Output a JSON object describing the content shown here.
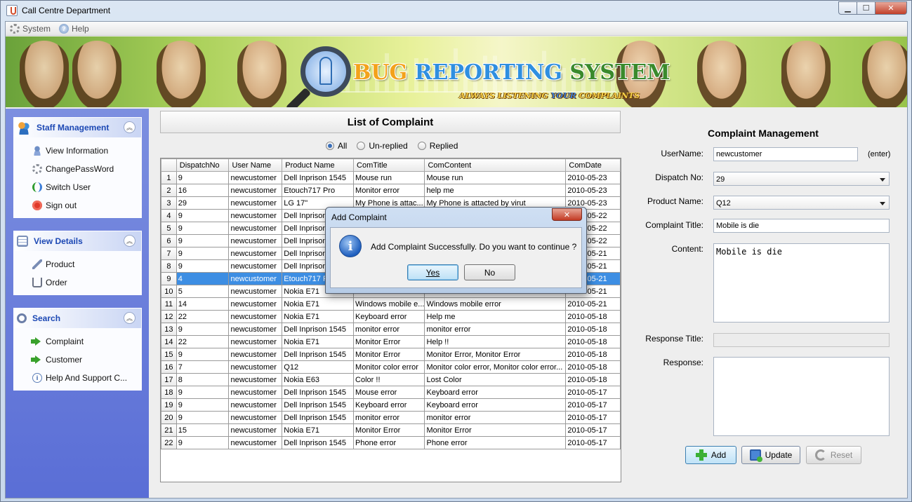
{
  "window": {
    "title": "Call Centre Department",
    "controls": {
      "minimize": "▁",
      "maximize": "☐",
      "close": "✕"
    }
  },
  "menu": [
    {
      "label": "System",
      "icon": "gear-icon"
    },
    {
      "label": "Help",
      "icon": "help-icon"
    }
  ],
  "banner": {
    "title_part1": "BUG ",
    "title_part2": "REPORTING ",
    "title_part3": "SYSTEM",
    "subtitle_part1": "ALWAYS LISTENING ",
    "subtitle_part2": "YOUR",
    "subtitle_part3": " COMPLAINTS"
  },
  "sidebar": {
    "groups": [
      {
        "title": "Staff Management",
        "icon": "staff-icon",
        "items": [
          {
            "label": "View Information",
            "icon": "user-icon"
          },
          {
            "label": "ChangePassWord",
            "icon": "gear-icon"
          },
          {
            "label": "Switch User",
            "icon": "switch-icon"
          },
          {
            "label": "Sign out",
            "icon": "power-icon"
          }
        ]
      },
      {
        "title": "View Details",
        "icon": "details-icon",
        "items": [
          {
            "label": "Product",
            "icon": "product-icon"
          },
          {
            "label": "Order",
            "icon": "cart-icon"
          }
        ]
      },
      {
        "title": "Search",
        "icon": "search-icon",
        "items": [
          {
            "label": "Complaint",
            "icon": "arrow-icon"
          },
          {
            "label": "Customer",
            "icon": "arrow-icon"
          },
          {
            "label": "Help And Support C...",
            "icon": "info-icon"
          }
        ]
      }
    ],
    "collapse_glyph": "︽"
  },
  "list": {
    "title": "List of Complaint",
    "filters": [
      {
        "label": "All",
        "selected": true
      },
      {
        "label": "Un-replied",
        "selected": false
      },
      {
        "label": "Replied",
        "selected": false
      }
    ],
    "columns": [
      "",
      "DispatchNo",
      "User Name",
      "Product Name",
      "ComTitle",
      "ComContent",
      "ComDate"
    ],
    "selected_row": 9,
    "rows": [
      [
        "1",
        "9",
        "newcustomer",
        "Dell Inprison 1545",
        "Mouse run",
        "Mouse run",
        "2010-05-23"
      ],
      [
        "2",
        "16",
        "newcustomer",
        "Etouch717 Pro",
        "Monitor error",
        "help me",
        "2010-05-23"
      ],
      [
        "3",
        "29",
        "newcustomer",
        "LG 17\"",
        "My Phone is attac...",
        "My Phone is attacted by virut",
        "2010-05-23"
      ],
      [
        "4",
        "9",
        "newcustomer",
        "Dell Inprison 1545",
        "",
        "",
        "2010-05-22"
      ],
      [
        "5",
        "9",
        "newcustomer",
        "Dell Inprison 1545",
        "",
        "",
        "2010-05-22"
      ],
      [
        "6",
        "9",
        "newcustomer",
        "Dell Inprison 1545",
        "",
        "",
        "2010-05-22"
      ],
      [
        "7",
        "9",
        "newcustomer",
        "Dell Inprison 1545",
        "",
        "",
        "2010-05-21"
      ],
      [
        "8",
        "9",
        "newcustomer",
        "Dell Inprison 1545",
        "",
        "",
        "2010-05-21"
      ],
      [
        "9",
        "4",
        "newcustomer",
        "Etouch717 Pro",
        "",
        "",
        "2010-05-21"
      ],
      [
        "10",
        "5",
        "newcustomer",
        "Nokia E71",
        "",
        "",
        "2010-05-21"
      ],
      [
        "11",
        "14",
        "newcustomer",
        "Nokia E71",
        "Windows mobile e...",
        "Windows mobile error",
        "2010-05-21"
      ],
      [
        "12",
        "22",
        "newcustomer",
        "Nokia E71",
        "Keyboard error",
        "Help me",
        "2010-05-18"
      ],
      [
        "13",
        "9",
        "newcustomer",
        "Dell Inprison 1545",
        "monitor error",
        "monitor error",
        "2010-05-18"
      ],
      [
        "14",
        "22",
        "newcustomer",
        "Nokia E71",
        "Monitor Error",
        "Help !!",
        "2010-05-18"
      ],
      [
        "15",
        "9",
        "newcustomer",
        "Dell Inprison 1545",
        "Monitor Error",
        "Monitor Error, Monitor Error",
        "2010-05-18"
      ],
      [
        "16",
        "7",
        "newcustomer",
        "Q12",
        "Monitor color error",
        "Monitor color error, Monitor color error...",
        "2010-05-18"
      ],
      [
        "17",
        "8",
        "newcustomer",
        "Nokia E63",
        "Color !!",
        "Lost Color",
        "2010-05-18"
      ],
      [
        "18",
        "9",
        "newcustomer",
        "Dell Inprison 1545",
        "Mouse error",
        "Keyboard error",
        "2010-05-17"
      ],
      [
        "19",
        "9",
        "newcustomer",
        "Dell Inprison 1545",
        "Keyboard error",
        "Keyboard error",
        "2010-05-17"
      ],
      [
        "20",
        "9",
        "newcustomer",
        "Dell Inprison 1545",
        "monitor error",
        "monitor error",
        "2010-05-17"
      ],
      [
        "21",
        "15",
        "newcustomer",
        "Nokia E71",
        "Monitor Error",
        "Monitor Error",
        "2010-05-17"
      ],
      [
        "22",
        "9",
        "newcustomer",
        "Dell Inprison 1545",
        "Phone error",
        "Phone error",
        "2010-05-17"
      ]
    ]
  },
  "form": {
    "title": "Complaint Management",
    "username_label": "UserName:",
    "username_value": "newcustomer",
    "enter_hint": "(enter)",
    "dispatch_label": "Dispatch No:",
    "dispatch_value": "29",
    "product_label": "Product Name:",
    "product_value": "Q12",
    "complaint_title_label": "Complaint Title:",
    "complaint_title_value": "Mobile is die",
    "content_label": "Content:",
    "content_value": "Mobile is die",
    "response_title_label": "Response Title:",
    "response_title_value": "",
    "response_label": "Response:",
    "response_value": "",
    "add_label": "Add",
    "update_label": "Update",
    "reset_label": "Reset"
  },
  "dialog": {
    "title": "Add Complaint",
    "close": "✕",
    "icon_glyph": "i",
    "message": "Add Complaint Successfully. Do you want to continue ?",
    "yes_label": "Yes",
    "no_label": "No"
  }
}
